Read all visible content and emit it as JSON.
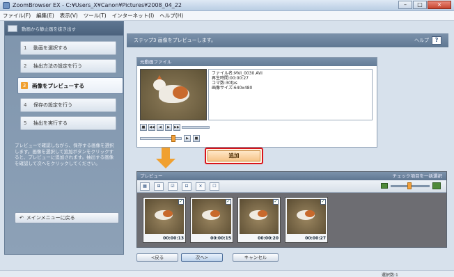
{
  "window": {
    "title": "ZoomBrowser EX - C:¥Users_X¥Canon¥Pictures¥2008_04_22",
    "controls": [
      "–",
      "□",
      "×"
    ]
  },
  "menu": [
    "ファイル(F)",
    "編集(E)",
    "表示(V)",
    "ツール(T)",
    "インターネット(I)",
    "ヘルプ(H)"
  ],
  "sidebar": {
    "header": "動画から静止画を抜き出す",
    "steps": [
      {
        "num": "1",
        "label": "動画を選択する"
      },
      {
        "num": "2",
        "label": "抽出方法の設定を行う"
      },
      {
        "num": "3",
        "label": "画像をプレビューする"
      },
      {
        "num": "4",
        "label": "保存の設定を行う"
      },
      {
        "num": "5",
        "label": "抽出を実行する"
      }
    ],
    "description": "プレビューで確認しながら、保存する画像を選択します。画像を選択して追加ボタンをクリックすると、プレビューに追加されます。抽出する画像を確認して次へをクリックしてください。",
    "back_menu": "メインメニューに戻る"
  },
  "content": {
    "header": "ステップ3 画像をプレビューします。",
    "help_label": "ヘルプ",
    "help_icon": "?"
  },
  "movie_panel": {
    "title": "元動画ファイル",
    "info": [
      "ファイル名:MVI_0030.AVI",
      "再生時間:00:00:27",
      "コマ数:30fps",
      "画像サイズ:640x480"
    ],
    "player_buttons": [
      "■",
      "◀◀",
      "◀",
      "▶",
      "▶▶"
    ],
    "seek_buttons": [
      "▶",
      "■"
    ]
  },
  "add_button": "追加",
  "preview_panel": {
    "title": "プレビュー",
    "right_label": "チェック項目を一括選択",
    "toolbar": [
      "▦",
      "⊞",
      "☑",
      "⊟",
      "✕",
      "☐"
    ],
    "frames": [
      {
        "time": "00:00:13",
        "checked": true
      },
      {
        "time": "00:00:15",
        "checked": true
      },
      {
        "time": "00:00:20",
        "checked": true
      },
      {
        "time": "00:00:27",
        "checked": true
      }
    ]
  },
  "nav": {
    "prev": "<戻る",
    "next": "次へ>",
    "cancel": "キャンセル"
  },
  "status": {
    "selected": "選択数:1"
  }
}
